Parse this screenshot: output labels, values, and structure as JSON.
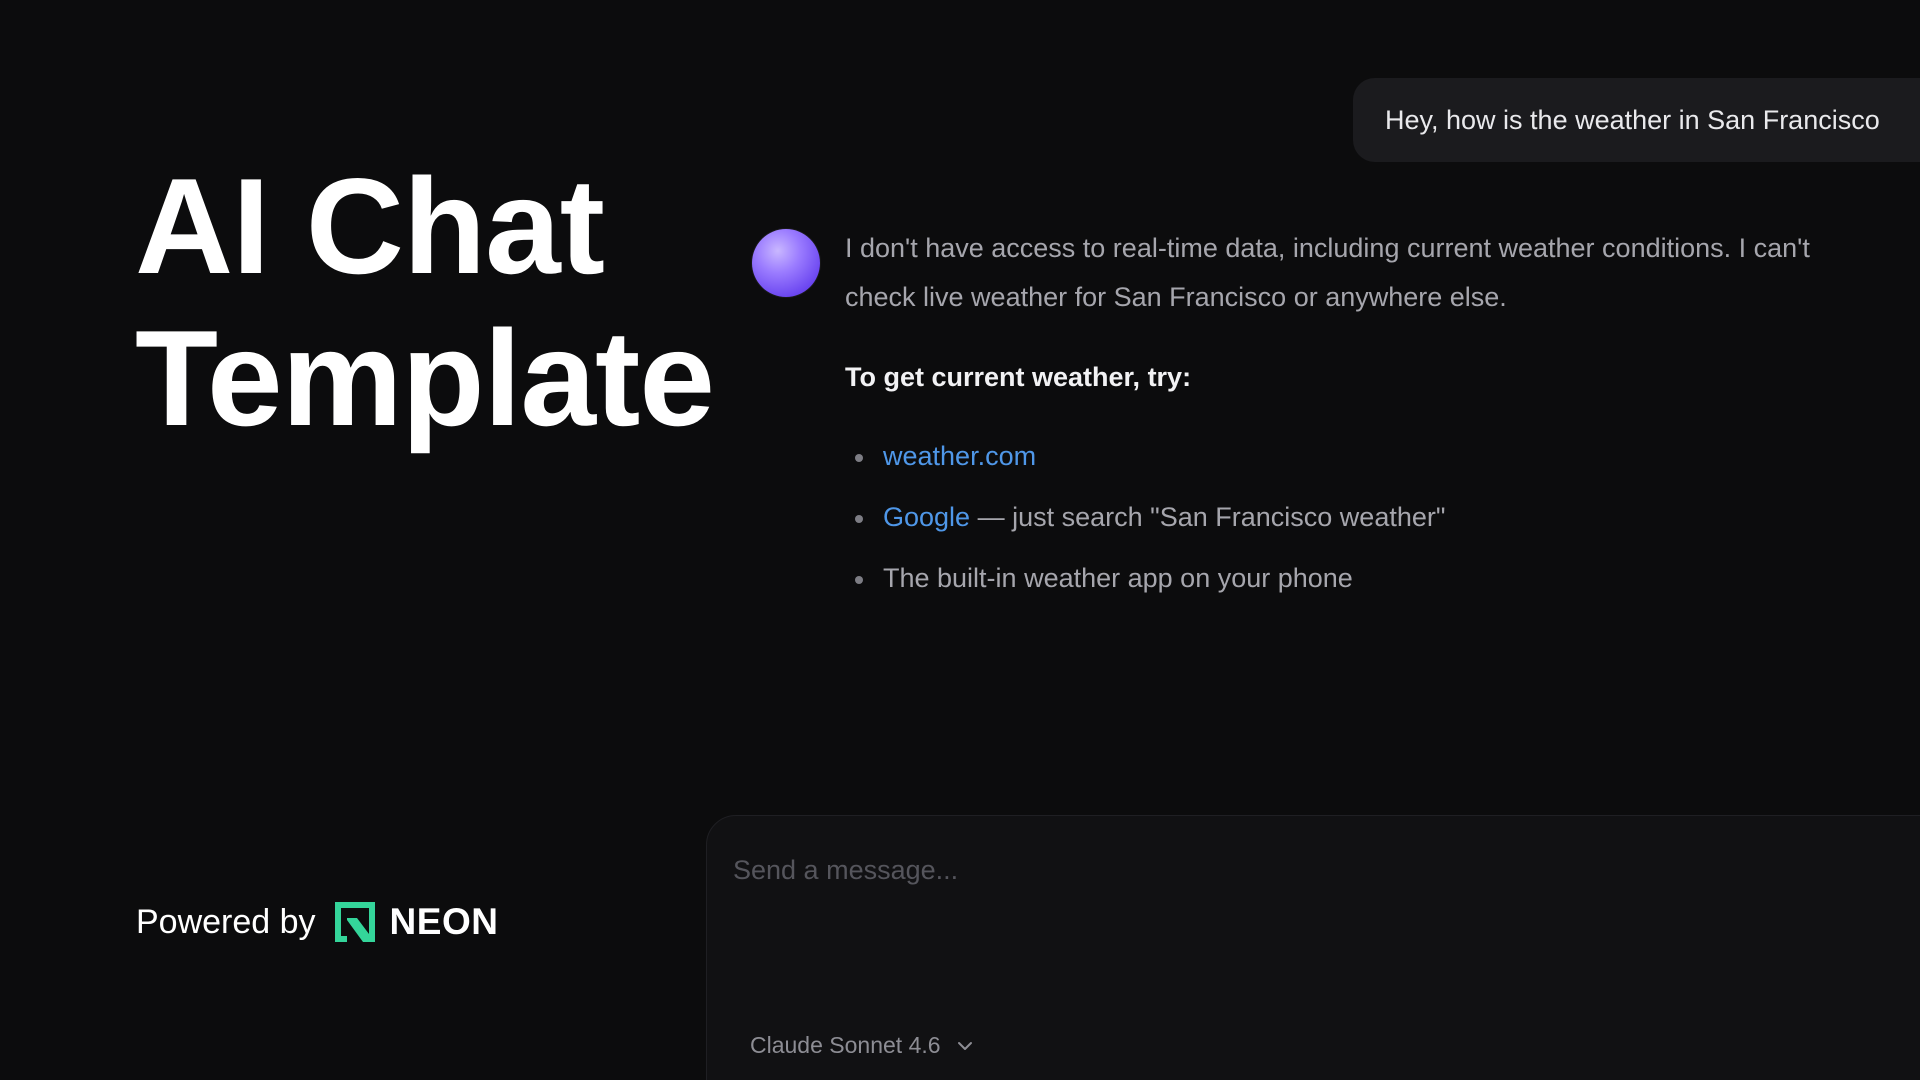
{
  "hero": {
    "title_line1": "AI Chat",
    "title_line2": "Template"
  },
  "footer": {
    "powered_by": "Powered by",
    "brand": "NEON",
    "brand_icon": "neon-logo-icon",
    "brand_color": "#34d59a"
  },
  "chat": {
    "user_message": "Hey, how is the weather in San Francisco",
    "assistant": {
      "avatar_icon": "assistant-orb-icon",
      "intro_line1": "I don't have access to real-time data, including current weather conditions. I can't",
      "intro_line2": "check live weather for San Francisco or anywhere else.",
      "heading": "To get current weather, try:",
      "items": [
        {
          "link": "weather.com",
          "text": ""
        },
        {
          "link": "Google",
          "text": " — just search \"San Francisco weather\""
        },
        {
          "link": "",
          "text": "The built-in weather app on your phone"
        }
      ]
    }
  },
  "composer": {
    "placeholder": "Send a message...",
    "value": "",
    "model": "Claude Sonnet 4.6",
    "model_icon": "chevron-down-icon"
  },
  "colors": {
    "background": "#0c0c0d",
    "link": "#4f97e8",
    "avatar": "#8b6cff"
  }
}
